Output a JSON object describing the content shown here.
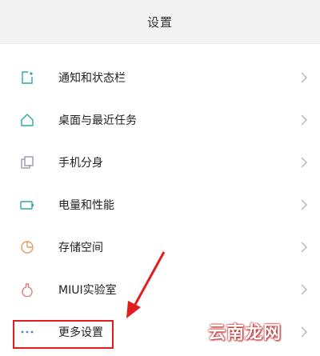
{
  "header": {
    "title": "设置"
  },
  "settings": {
    "items": [
      {
        "label": "通知和状态栏",
        "icon": "notification-icon"
      },
      {
        "label": "桌面与最近任务",
        "icon": "home-icon"
      },
      {
        "label": "手机分身",
        "icon": "dual-space-icon"
      },
      {
        "label": "电量和性能",
        "icon": "battery-icon"
      },
      {
        "label": "存储空间",
        "icon": "storage-icon"
      },
      {
        "label": "MIUI实验室",
        "icon": "lab-flask-icon"
      },
      {
        "label": "更多设置",
        "icon": "more-dots-icon"
      }
    ]
  },
  "colors": {
    "accent": "#2ba7a1",
    "annotation": "#e11d1d"
  },
  "watermark": {
    "text": "云南龙网"
  }
}
